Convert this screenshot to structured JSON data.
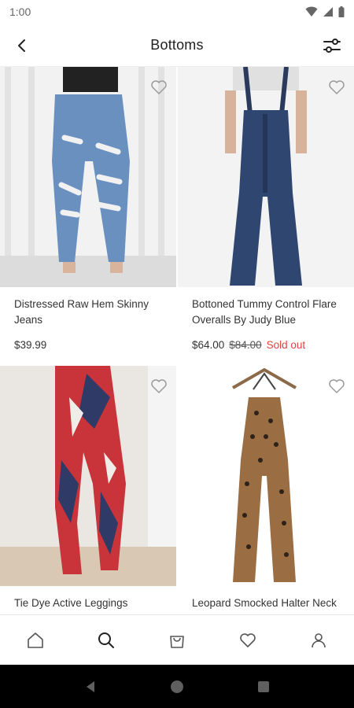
{
  "status_bar": {
    "time": "1:00"
  },
  "header": {
    "title": "Bottoms"
  },
  "products": [
    {
      "name": "Distressed Raw Hem Skinny Jeans",
      "price": "$39.99",
      "original_price": "",
      "status": ""
    },
    {
      "name": "Bottoned Tummy Control Flare Overalls By Judy Blue",
      "price": "$64.00",
      "original_price": "$84.00",
      "status": "Sold out"
    },
    {
      "name": "Tie Dye Active Leggings",
      "price": "",
      "original_price": "",
      "status": ""
    },
    {
      "name": "Leopard Smocked Halter Neck",
      "price": "",
      "original_price": "",
      "status": ""
    }
  ],
  "bottom_nav": [
    "home-icon",
    "search-icon",
    "bag-icon",
    "heart-icon",
    "profile-icon"
  ],
  "colors": {
    "sold_out": "#e0443c",
    "system_nav": "#000000"
  }
}
